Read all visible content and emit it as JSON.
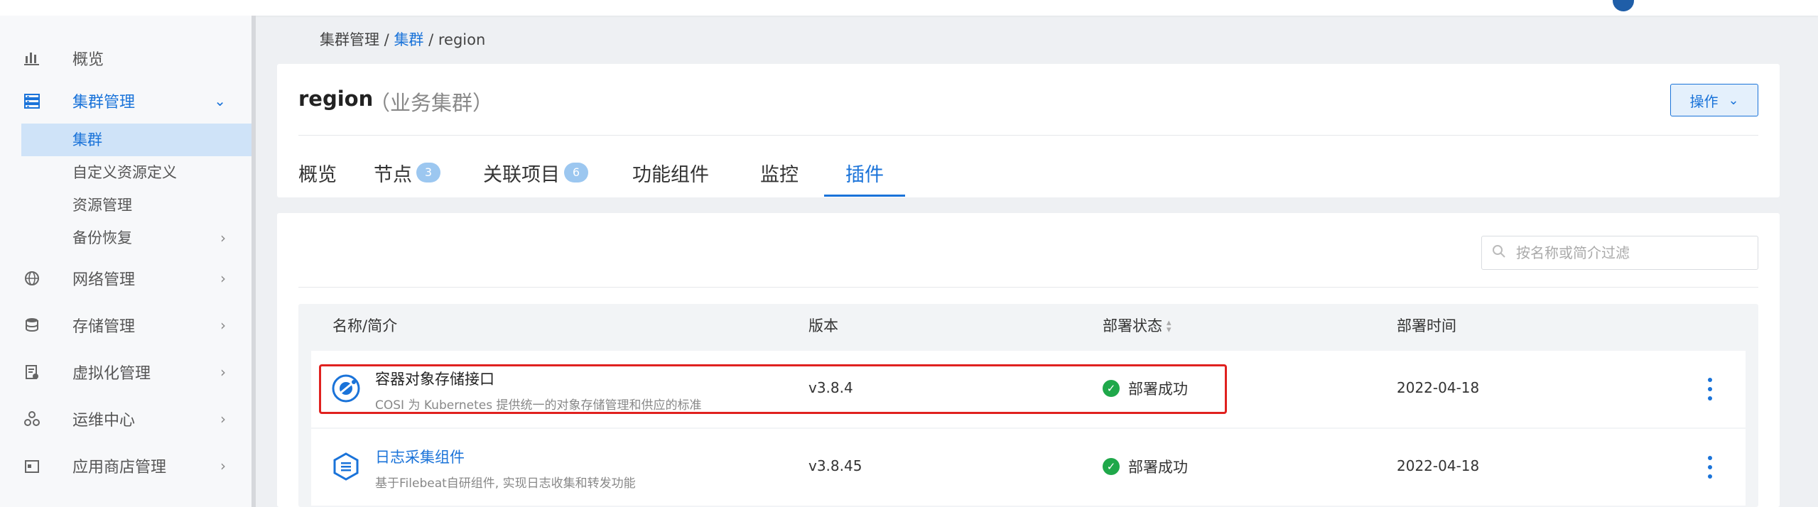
{
  "sidebar": {
    "items": [
      {
        "label": "概览",
        "icon": "bar-chart-icon"
      },
      {
        "label": "集群管理",
        "icon": "server-icon"
      },
      {
        "label": "网络管理",
        "icon": "globe-icon"
      },
      {
        "label": "存储管理",
        "icon": "database-icon"
      },
      {
        "label": "虚拟化管理",
        "icon": "vm-icon"
      },
      {
        "label": "运维中心",
        "icon": "ops-icon"
      },
      {
        "label": "应用商店管理",
        "icon": "store-icon"
      }
    ],
    "cluster_sub": [
      {
        "label": "集群"
      },
      {
        "label": "自定义资源定义"
      },
      {
        "label": "资源管理"
      },
      {
        "label": "备份恢复"
      }
    ]
  },
  "breadcrumb": {
    "part1": "集群管理",
    "sep1": " / ",
    "part2": "集群",
    "sep2": " / ",
    "part3": "region"
  },
  "header": {
    "title": "region",
    "subtitle": "（业务集群）",
    "action_label": "操作",
    "tabs": [
      {
        "label": "概览"
      },
      {
        "label": "节点",
        "badge": "3"
      },
      {
        "label": "关联项目",
        "badge": "6"
      },
      {
        "label": "功能组件"
      },
      {
        "label": "监控"
      },
      {
        "label": "插件"
      }
    ]
  },
  "filter": {
    "placeholder": "按名称或简介过滤"
  },
  "table": {
    "columns": [
      "名称/简介",
      "版本",
      "部署状态",
      "部署时间"
    ],
    "rows": [
      {
        "name": "容器对象存储接口",
        "desc": "COSI 为 Kubernetes 提供统一的对象存储管理和供应的标准",
        "version": "v3.8.4",
        "status": "部署成功",
        "time": "2022-04-18",
        "icon": "cosi-icon"
      },
      {
        "name": "日志采集组件",
        "desc": "基于Filebeat自研组件, 实现日志收集和转发功能",
        "version": "v3.8.45",
        "status": "部署成功",
        "time": "2022-04-18",
        "icon": "log-collector-icon"
      }
    ]
  },
  "colors": {
    "accent": "#1a73d9",
    "success": "#1fa84a",
    "highlight": "#e0211f"
  }
}
